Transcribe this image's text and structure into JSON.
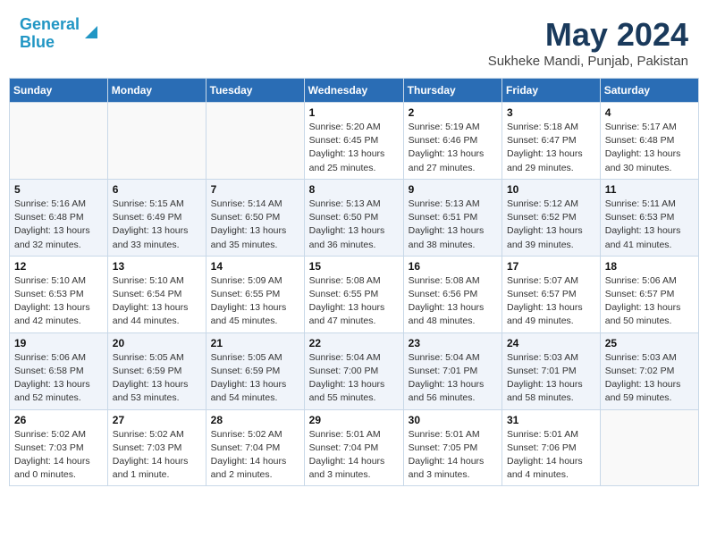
{
  "header": {
    "logo_line1": "General",
    "logo_line2": "Blue",
    "month_title": "May 2024",
    "location": "Sukheke Mandi, Punjab, Pakistan"
  },
  "weekdays": [
    "Sunday",
    "Monday",
    "Tuesday",
    "Wednesday",
    "Thursday",
    "Friday",
    "Saturday"
  ],
  "weeks": [
    [
      {
        "day": "",
        "info": ""
      },
      {
        "day": "",
        "info": ""
      },
      {
        "day": "",
        "info": ""
      },
      {
        "day": "1",
        "info": "Sunrise: 5:20 AM\nSunset: 6:45 PM\nDaylight: 13 hours\nand 25 minutes."
      },
      {
        "day": "2",
        "info": "Sunrise: 5:19 AM\nSunset: 6:46 PM\nDaylight: 13 hours\nand 27 minutes."
      },
      {
        "day": "3",
        "info": "Sunrise: 5:18 AM\nSunset: 6:47 PM\nDaylight: 13 hours\nand 29 minutes."
      },
      {
        "day": "4",
        "info": "Sunrise: 5:17 AM\nSunset: 6:48 PM\nDaylight: 13 hours\nand 30 minutes."
      }
    ],
    [
      {
        "day": "5",
        "info": "Sunrise: 5:16 AM\nSunset: 6:48 PM\nDaylight: 13 hours\nand 32 minutes."
      },
      {
        "day": "6",
        "info": "Sunrise: 5:15 AM\nSunset: 6:49 PM\nDaylight: 13 hours\nand 33 minutes."
      },
      {
        "day": "7",
        "info": "Sunrise: 5:14 AM\nSunset: 6:50 PM\nDaylight: 13 hours\nand 35 minutes."
      },
      {
        "day": "8",
        "info": "Sunrise: 5:13 AM\nSunset: 6:50 PM\nDaylight: 13 hours\nand 36 minutes."
      },
      {
        "day": "9",
        "info": "Sunrise: 5:13 AM\nSunset: 6:51 PM\nDaylight: 13 hours\nand 38 minutes."
      },
      {
        "day": "10",
        "info": "Sunrise: 5:12 AM\nSunset: 6:52 PM\nDaylight: 13 hours\nand 39 minutes."
      },
      {
        "day": "11",
        "info": "Sunrise: 5:11 AM\nSunset: 6:53 PM\nDaylight: 13 hours\nand 41 minutes."
      }
    ],
    [
      {
        "day": "12",
        "info": "Sunrise: 5:10 AM\nSunset: 6:53 PM\nDaylight: 13 hours\nand 42 minutes."
      },
      {
        "day": "13",
        "info": "Sunrise: 5:10 AM\nSunset: 6:54 PM\nDaylight: 13 hours\nand 44 minutes."
      },
      {
        "day": "14",
        "info": "Sunrise: 5:09 AM\nSunset: 6:55 PM\nDaylight: 13 hours\nand 45 minutes."
      },
      {
        "day": "15",
        "info": "Sunrise: 5:08 AM\nSunset: 6:55 PM\nDaylight: 13 hours\nand 47 minutes."
      },
      {
        "day": "16",
        "info": "Sunrise: 5:08 AM\nSunset: 6:56 PM\nDaylight: 13 hours\nand 48 minutes."
      },
      {
        "day": "17",
        "info": "Sunrise: 5:07 AM\nSunset: 6:57 PM\nDaylight: 13 hours\nand 49 minutes."
      },
      {
        "day": "18",
        "info": "Sunrise: 5:06 AM\nSunset: 6:57 PM\nDaylight: 13 hours\nand 50 minutes."
      }
    ],
    [
      {
        "day": "19",
        "info": "Sunrise: 5:06 AM\nSunset: 6:58 PM\nDaylight: 13 hours\nand 52 minutes."
      },
      {
        "day": "20",
        "info": "Sunrise: 5:05 AM\nSunset: 6:59 PM\nDaylight: 13 hours\nand 53 minutes."
      },
      {
        "day": "21",
        "info": "Sunrise: 5:05 AM\nSunset: 6:59 PM\nDaylight: 13 hours\nand 54 minutes."
      },
      {
        "day": "22",
        "info": "Sunrise: 5:04 AM\nSunset: 7:00 PM\nDaylight: 13 hours\nand 55 minutes."
      },
      {
        "day": "23",
        "info": "Sunrise: 5:04 AM\nSunset: 7:01 PM\nDaylight: 13 hours\nand 56 minutes."
      },
      {
        "day": "24",
        "info": "Sunrise: 5:03 AM\nSunset: 7:01 PM\nDaylight: 13 hours\nand 58 minutes."
      },
      {
        "day": "25",
        "info": "Sunrise: 5:03 AM\nSunset: 7:02 PM\nDaylight: 13 hours\nand 59 minutes."
      }
    ],
    [
      {
        "day": "26",
        "info": "Sunrise: 5:02 AM\nSunset: 7:03 PM\nDaylight: 14 hours\nand 0 minutes."
      },
      {
        "day": "27",
        "info": "Sunrise: 5:02 AM\nSunset: 7:03 PM\nDaylight: 14 hours\nand 1 minute."
      },
      {
        "day": "28",
        "info": "Sunrise: 5:02 AM\nSunset: 7:04 PM\nDaylight: 14 hours\nand 2 minutes."
      },
      {
        "day": "29",
        "info": "Sunrise: 5:01 AM\nSunset: 7:04 PM\nDaylight: 14 hours\nand 3 minutes."
      },
      {
        "day": "30",
        "info": "Sunrise: 5:01 AM\nSunset: 7:05 PM\nDaylight: 14 hours\nand 3 minutes."
      },
      {
        "day": "31",
        "info": "Sunrise: 5:01 AM\nSunset: 7:06 PM\nDaylight: 14 hours\nand 4 minutes."
      },
      {
        "day": "",
        "info": ""
      }
    ]
  ]
}
